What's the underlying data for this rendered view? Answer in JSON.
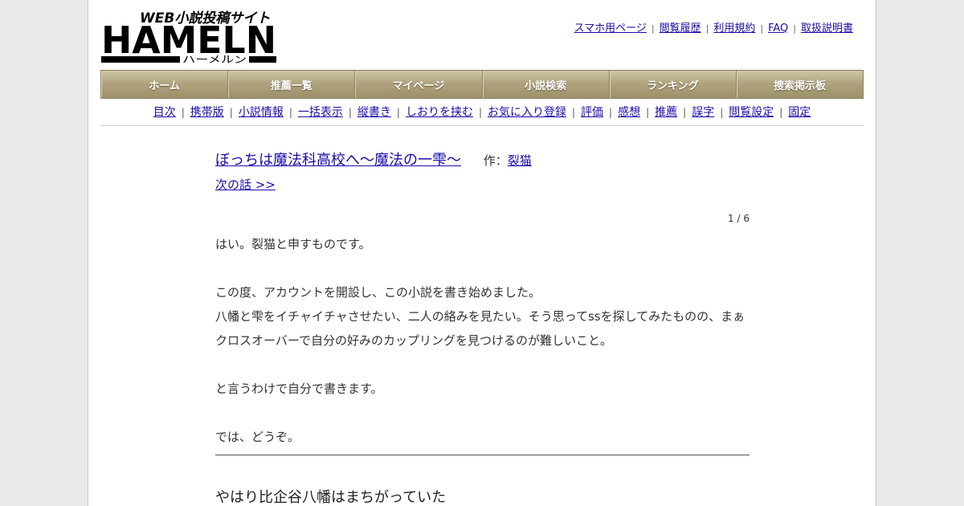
{
  "logo": {
    "main_text": "HAMELN",
    "tagline": "WEB小説投稿サイト",
    "kana": "ハーメルン"
  },
  "top_links": [
    {
      "label": "スマホ用ページ"
    },
    {
      "label": "閲覧履歴"
    },
    {
      "label": "利用規約"
    },
    {
      "label": "FAQ"
    },
    {
      "label": "取扱説明書"
    }
  ],
  "main_nav": [
    {
      "label": "ホーム"
    },
    {
      "label": "推薦一覧"
    },
    {
      "label": "マイページ"
    },
    {
      "label": "小説検索"
    },
    {
      "label": "ランキング"
    },
    {
      "label": "捜索掲示板"
    }
  ],
  "sub_nav": [
    {
      "label": "目次"
    },
    {
      "label": "携帯版"
    },
    {
      "label": "小説情報"
    },
    {
      "label": "一括表示"
    },
    {
      "label": "縦書き"
    },
    {
      "label": "しおりを挟む"
    },
    {
      "label": "お気に入り登録"
    },
    {
      "label": "評価"
    },
    {
      "label": "感想"
    },
    {
      "label": "推薦"
    },
    {
      "label": "誤字"
    },
    {
      "label": "閲覧設定"
    },
    {
      "label": "固定"
    }
  ],
  "novel": {
    "title": "ぼっちは魔法科高校へ〜魔法の一雫〜",
    "author_prefix": "作：",
    "author": "裂猫",
    "next_link": "次の話 >>",
    "page_indicator": "1 / 6",
    "paragraphs": [
      "はい。裂猫と申すものです。",
      "",
      "この度、アカウントを開設し、この小説を書き始めました。",
      "八幡と雫をイチャイチャさせたい、二人の絡みを見たい。そう思ってssを探してみたものの、まぁ",
      "クロスオーバーで自分の好みのカップリングを見つけるのが難しいこと。",
      "",
      "と言うわけで自分で書きます。",
      "",
      "では、どうぞ。"
    ],
    "chapter_title": "やはり比企谷八幡はまちがっていた"
  }
}
